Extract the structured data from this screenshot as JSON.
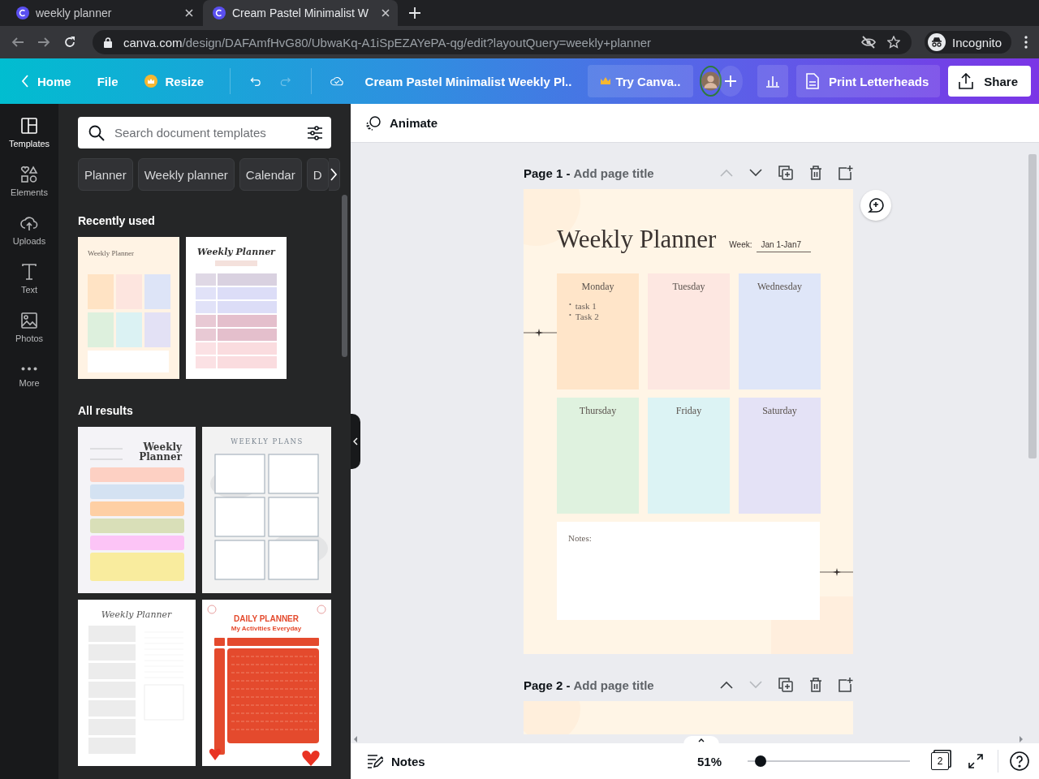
{
  "browser": {
    "tabs": [
      {
        "title": "weekly planner",
        "selected": false
      },
      {
        "title": "Cream Pastel Minimalist W",
        "selected": true
      }
    ],
    "url_host": "canva.com",
    "url_path": "/design/DAFAmfHvG80/UbwaKq-A1iSpEZAYePA-qg/edit?layoutQuery=weekly+planner",
    "profile": "Incognito"
  },
  "toolbar": {
    "home": "Home",
    "file": "File",
    "resize": "Resize",
    "design_title": "Cream Pastel Minimalist Weekly Pl..",
    "try": "Try Canva..",
    "print": "Print Letterheads",
    "share": "Share"
  },
  "rail": [
    {
      "label": "Templates",
      "selected": true
    },
    {
      "label": "Elements",
      "selected": false
    },
    {
      "label": "Uploads",
      "selected": false
    },
    {
      "label": "Text",
      "selected": false
    },
    {
      "label": "Photos",
      "selected": false
    },
    {
      "label": "More",
      "selected": false
    }
  ],
  "panel": {
    "search": {
      "placeholder": "Search document templates"
    },
    "chips": [
      "Planner",
      "Weekly planner",
      "Calendar",
      "D"
    ],
    "recent_heading": "Recently used",
    "recent": [
      {
        "kind": "pastel-grid",
        "title": "Weekly Planner"
      },
      {
        "kind": "rows",
        "title": "Weekly Planner"
      }
    ],
    "results_heading": "All results",
    "results": [
      {
        "kind": "colour-bars",
        "title": "Weekly Planner"
      },
      {
        "kind": "boxes",
        "title": "WEEKLY PLANS"
      },
      {
        "kind": "lined",
        "title": "Weekly Planner"
      },
      {
        "kind": "daily",
        "title": "DAILY PLANNER",
        "subtitle": "My Activities Everyday"
      }
    ]
  },
  "canvas": {
    "animate": "Animate",
    "pages": [
      {
        "label": "Page 1 -",
        "title_placeholder": "Add page title",
        "up_disabled": true,
        "down_disabled": false
      },
      {
        "label": "Page 2 -",
        "title_placeholder": "Add page title",
        "up_disabled": false,
        "down_disabled": true
      }
    ],
    "planner": {
      "title": "Weekly Planner",
      "week_label": "Week:",
      "week_value": "Jan 1-Jan7",
      "days": [
        {
          "name": "Monday",
          "color": "#ffe5c9",
          "items": [
            {
              "bullet": "•",
              "text": "task 1"
            },
            {
              "bullet": "•",
              "text": "Task 2"
            }
          ]
        },
        {
          "name": "Tuesday",
          "color": "#fde7e1"
        },
        {
          "name": "Wednesday",
          "color": "#dfe6f8"
        },
        {
          "name": "Thursday",
          "color": "#dff2df"
        },
        {
          "name": "Friday",
          "color": "#dcf3f4"
        },
        {
          "name": "Saturday",
          "color": "#e4e2f6"
        }
      ],
      "notes": "Notes:"
    }
  },
  "footer": {
    "notes": "Notes",
    "zoom": "51%",
    "zoom_slider": {
      "level": 0.08
    },
    "page_count": "2"
  }
}
